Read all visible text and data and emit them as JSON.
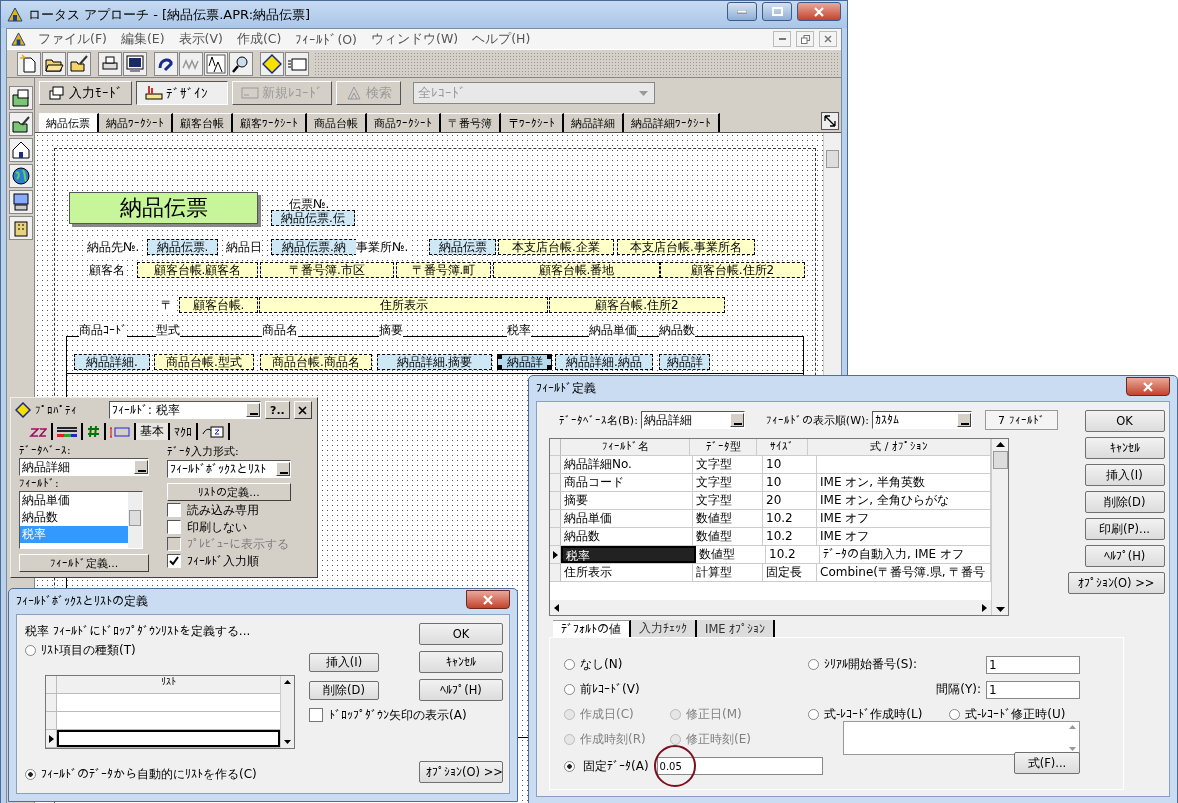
{
  "window": {
    "title": "ロータス アプローチ - [納品伝票.APR:納品伝票]"
  },
  "menu": [
    "ファイル(F)",
    "編集(E)",
    "表示(V)",
    "作成(C)",
    "ﾌｨｰﾙﾄﾞ(O)",
    "ウィンドウ(W)",
    "ヘルプ(H)"
  ],
  "mode_bar": {
    "buttons": [
      {
        "label": "入力ﾓｰﾄﾞ",
        "kind": "input-mode",
        "selected": false,
        "disabled": false
      },
      {
        "label": "ﾃﾞｻﾞｲﾝ",
        "kind": "design",
        "selected": true,
        "disabled": false
      },
      {
        "label": "新規ﾚｺｰﾄﾞ",
        "kind": "new-record",
        "selected": false,
        "disabled": true
      },
      {
        "label": "検索",
        "kind": "find",
        "selected": false,
        "disabled": true
      }
    ],
    "record_filter": {
      "value": "全ﾚｺｰﾄﾞ",
      "disabled": true
    }
  },
  "view_tabs": [
    {
      "label": "納品伝票",
      "selected": true
    },
    {
      "label": "納品ﾜｰｸｼｰﾄ",
      "selected": false
    },
    {
      "label": "顧客台帳",
      "selected": false
    },
    {
      "label": "顧客ﾜｰｸｼｰﾄ",
      "selected": false
    },
    {
      "label": "商品台帳",
      "selected": false
    },
    {
      "label": "商品ﾜｰｸｼｰﾄ",
      "selected": false
    },
    {
      "label": "〒番号簿",
      "selected": false
    },
    {
      "label": "〒ﾜｰｸｼｰﾄ",
      "selected": false
    },
    {
      "label": "納品詳細",
      "selected": false
    },
    {
      "label": "納品詳細ﾜｰｸｼｰﾄ",
      "selected": false
    }
  ],
  "form": {
    "title": "納品伝票",
    "items": [
      {
        "text": "伝票№.",
        "kind": "label",
        "selected": false
      },
      {
        "text": "納品伝票.伝",
        "kind": "main-field",
        "selected": false
      },
      {
        "text": "納品先№.",
        "kind": "label",
        "selected": false
      },
      {
        "text": "納品伝票.",
        "kind": "main-field",
        "selected": false
      },
      {
        "text": "納品日",
        "kind": "label",
        "selected": false
      },
      {
        "text": "納品伝票.納",
        "kind": "main-field",
        "selected": false
      },
      {
        "text": "事業所№.",
        "kind": "label",
        "selected": false
      },
      {
        "text": "納品伝票",
        "kind": "main-field",
        "selected": false
      },
      {
        "text": "本支店台帳.企業",
        "kind": "related-field",
        "selected": false
      },
      {
        "text": "本支店台帳.事業所名",
        "kind": "related-field",
        "selected": false
      },
      {
        "text": "顧客名",
        "kind": "label",
        "selected": false
      },
      {
        "text": "顧客台帳.顧客名",
        "kind": "related-field",
        "selected": false
      },
      {
        "text": "〒番号簿.市区",
        "kind": "related-field",
        "selected": false
      },
      {
        "text": "〒番号簿.町",
        "kind": "related-field",
        "selected": false
      },
      {
        "text": "顧客台帳.番地",
        "kind": "related-field",
        "selected": false
      },
      {
        "text": "顧客台帳.住所2",
        "kind": "related-field",
        "selected": false
      },
      {
        "text": "〒",
        "kind": "label",
        "selected": false
      },
      {
        "text": "顧客台帳.",
        "kind": "related-field",
        "selected": false
      },
      {
        "text": "住所表示",
        "kind": "related-field",
        "selected": false
      },
      {
        "text": "顧客台帳.住所2",
        "kind": "related-field",
        "selected": false
      },
      {
        "text": "商品ｺｰﾄﾞ",
        "kind": "label",
        "selected": false
      },
      {
        "text": "型式",
        "kind": "label",
        "selected": false
      },
      {
        "text": "商品名",
        "kind": "label",
        "selected": false
      },
      {
        "text": "摘要",
        "kind": "label",
        "selected": false
      },
      {
        "text": "税率",
        "kind": "label",
        "selected": false
      },
      {
        "text": "納品単価",
        "kind": "label",
        "selected": false
      },
      {
        "text": "納品数",
        "kind": "label",
        "selected": false
      },
      {
        "text": "納品詳細.",
        "kind": "main-field",
        "selected": false
      },
      {
        "text": "商品台帳.型式",
        "kind": "related-field",
        "selected": false
      },
      {
        "text": "商品台帳.商品名",
        "kind": "related-field",
        "selected": false
      },
      {
        "text": "納品詳細.摘要",
        "kind": "main-field",
        "selected": false
      },
      {
        "text": "納品詳",
        "kind": "main-field",
        "selected": true
      },
      {
        "text": "納品詳細.納品",
        "kind": "main-field",
        "selected": false
      },
      {
        "text": "納品詳",
        "kind": "main-field",
        "selected": false
      }
    ]
  },
  "properties": {
    "title": "ﾌﾟﾛﾊﾟﾃｨ",
    "object_selector": "ﾌｨｰﾙﾄﾞ: 税率",
    "help_button": "?..",
    "tabs": [
      {
        "kind": "font",
        "selected": false
      },
      {
        "kind": "lines",
        "selected": false
      },
      {
        "kind": "number",
        "selected": false
      },
      {
        "kind": "frame",
        "selected": false
      },
      {
        "kind": "text",
        "label": "基本",
        "selected": true
      },
      {
        "kind": "text",
        "label": "ﾏｸﾛ",
        "selected": false
      },
      {
        "kind": "script",
        "selected": false
      }
    ],
    "database_label": "ﾃﾞｰﾀﾍﾞｰｽ:",
    "database": "納品詳細",
    "field_label": "ﾌｨｰﾙﾄﾞ:",
    "fields": [
      {
        "label": "納品単価",
        "selected": false
      },
      {
        "label": "納品数",
        "selected": false
      },
      {
        "label": "税率",
        "selected": true
      }
    ],
    "input_format_label": "ﾃﾞｰﾀ入力形式:",
    "input_format": "ﾌｨｰﾙﾄﾞﾎﾞｯｸｽとﾘｽﾄ",
    "define_list_button": "ﾘｽﾄの定義...",
    "options": [
      {
        "label": "読み込み専用",
        "checked": false,
        "disabled": false
      },
      {
        "label": "印刷しない",
        "checked": false,
        "disabled": false
      },
      {
        "label": "ﾌﾟﾚﾋﾞｭｰに表示する",
        "checked": false,
        "disabled": true
      },
      {
        "label": "ﾌｨｰﾙﾄﾞ入力順",
        "checked": true,
        "disabled": false
      }
    ],
    "field_definition_button": "ﾌｨｰﾙﾄﾞ定義..."
  },
  "list_dialog": {
    "title": "ﾌｨｰﾙﾄﾞﾎﾞｯｸｽとﾘｽﾄの定義",
    "prompt": "税率 ﾌｨｰﾙﾄﾞにﾄﾞﾛｯﾌﾟﾀﾞｳﾝﾘｽﾄを定義する...",
    "sources": [
      {
        "label": "ﾘｽﾄ項目の種類(T)",
        "selected": false
      },
      {
        "label": "ﾌｨｰﾙﾄﾞのﾃﾞｰﾀから自動的にﾘｽﾄを作る(C)",
        "selected": true
      }
    ],
    "list_column": "ﾘｽﾄ",
    "row_buttons": [
      "挿入(I)",
      "削除(D)"
    ],
    "show_arrow": {
      "label": "ﾄﾞﾛｯﾌﾟﾀﾞｳﾝ矢印の表示(A)",
      "checked": false
    },
    "buttons": [
      "OK",
      "ｷｬﾝｾﾙ",
      "ﾍﾙﾌﾟ(H)"
    ],
    "options_button": "ｵﾌﾟｼｮﾝ(O) >>"
  },
  "field_dialog": {
    "title": "ﾌｨｰﾙﾄﾞ定義",
    "database_label": "ﾃﾞｰﾀﾍﾞｰｽ名(B):",
    "database": "納品詳細",
    "order_label": "ﾌｨｰﾙﾄﾞの表示順(W):",
    "order": "ｶｽﾀﾑ",
    "field_count": "7 ﾌｨｰﾙﾄﾞ",
    "columns": [
      "ﾌｨｰﾙﾄﾞ名",
      "ﾃﾞｰﾀ型",
      "ｻｲｽﾞ",
      "式 / ｵﾌﾟｼｮﾝ"
    ],
    "rows": [
      {
        "cells": [
          "納品詳細No.",
          "文字型",
          "10",
          ""
        ],
        "selected": false
      },
      {
        "cells": [
          "商品コード",
          "文字型",
          "10",
          "IME オン, 半角英数"
        ],
        "selected": false
      },
      {
        "cells": [
          "摘要",
          "文字型",
          "20",
          "IME オン, 全角ひらがな"
        ],
        "selected": false
      },
      {
        "cells": [
          "納品単価",
          "数値型",
          "10.2",
          "IME オフ"
        ],
        "selected": false
      },
      {
        "cells": [
          "納品数",
          "数値型",
          "10.2",
          "IME オフ"
        ],
        "selected": false
      },
      {
        "cells": [
          "税率",
          "数値型",
          "10.2",
          "ﾃﾞｰﾀの自動入力, IME オフ"
        ],
        "selected": true
      },
      {
        "cells": [
          "住所表示",
          "計算型",
          "固定長",
          "Combine(〒番号簿.県, 〒番号"
        ],
        "selected": false
      }
    ],
    "buttons": [
      "OK",
      "ｷｬﾝｾﾙ",
      "挿入(I)",
      "削除(D)",
      "印刷(P)...",
      "ﾍﾙﾌﾟ(H)"
    ],
    "options_button": "ｵﾌﾟｼｮﾝ(O) >>",
    "tabs": [
      {
        "label": "ﾃﾞﾌｫﾙﾄの値",
        "selected": true
      },
      {
        "label": "入力ﾁｪｯｸ",
        "selected": false
      },
      {
        "label": "IME ｵﾌﾟｼｮﾝ",
        "selected": false
      }
    ],
    "defaults": [
      {
        "label": "なし(N)",
        "selected": false,
        "disabled": false
      },
      {
        "label": "ｼﾘｱﾙ開始番号(S):",
        "selected": false,
        "disabled": false,
        "value": "1"
      },
      {
        "label": "前ﾚｺｰﾄﾞ(V)",
        "selected": false,
        "disabled": false
      },
      {
        "label": "作成日(C)",
        "selected": false,
        "disabled": true
      },
      {
        "label": "修正日(M)",
        "selected": false,
        "disabled": true
      },
      {
        "label": "式-ﾚｺｰﾄﾞ作成時(L)",
        "selected": false,
        "disabled": false
      },
      {
        "label": "式-ﾚｺｰﾄﾞ修正時(U)",
        "selected": false,
        "disabled": false
      },
      {
        "label": "作成時刻(R)",
        "selected": false,
        "disabled": true
      },
      {
        "label": "修正時刻(E)",
        "selected": false,
        "disabled": true
      },
      {
        "label": "固定ﾃﾞｰﾀ(A)",
        "selected": true,
        "disabled": false,
        "value": "0.05"
      }
    ],
    "interval": {
      "label": "間隔(Y):",
      "value": "1"
    },
    "formula_button": "式(F)..."
  }
}
